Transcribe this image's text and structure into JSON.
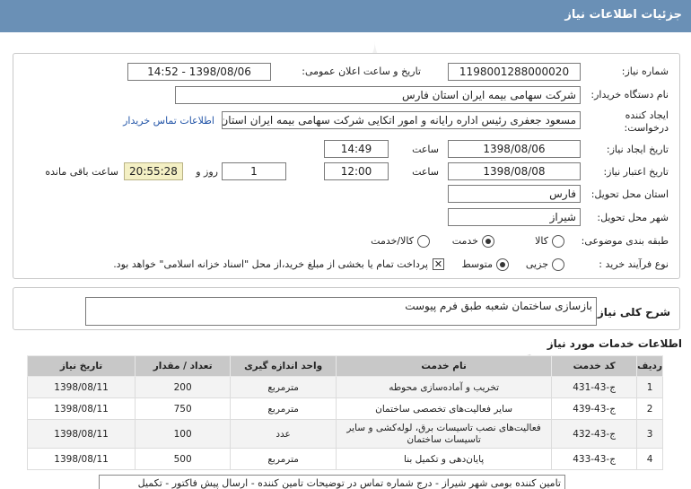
{
  "header": {
    "title": "جزئيات اطلاعات نیاز"
  },
  "form": {
    "need_number": {
      "label": "شماره نیاز:",
      "value": "1198001288000020"
    },
    "announce": {
      "label": "تاریخ و ساعت اعلان عمومی:",
      "value": "1398/08/06 - 14:52"
    },
    "buyer": {
      "label": "نام دستگاه خریدار:",
      "value": "شرکت سهامی بیمه ایران استان فارس"
    },
    "requester": {
      "label_line1": "ایجاد کننده",
      "label_line2": "درخواست:",
      "value": "مسعود جعفری رئیس اداره رایانه و امور اتکایی شرکت سهامی بیمه ایران استان",
      "contact_link": "اطلاعات تماس خریدار"
    },
    "created": {
      "label": "تاریخ ایجاد نیاز:",
      "date": "1398/08/06",
      "time_label": "ساعت",
      "time": "14:49"
    },
    "validity": {
      "label": "تاریخ اعتبار نیاز:",
      "date": "1398/08/08",
      "time_label": "ساعت",
      "time": "12:00",
      "days": "1",
      "days_label": "روز و",
      "remaining": "20:55:28",
      "remaining_label": "ساعت باقی مانده"
    },
    "province": {
      "label": "استان محل تحویل:",
      "value": "فارس"
    },
    "city": {
      "label": "شهر محل تحویل:",
      "value": "شیراز"
    },
    "category": {
      "label": "طبقه بندی موضوعی:",
      "options": [
        "کالا",
        "خدمت",
        "کالا/خدمت"
      ],
      "selected": "خدمت"
    },
    "process": {
      "label": "نوع فرآیند خرید :",
      "options": [
        "جزیی",
        "متوسط"
      ],
      "selected": "متوسط",
      "note": "پرداخت تمام یا بخشی از مبلغ خرید،از محل \"اسناد خزانه اسلامی\" خواهد بود."
    }
  },
  "description": {
    "label": "شرح کلی نیاز:",
    "value": "بازسازی ساختمان شعبه طبق فرم پیوست"
  },
  "services": {
    "title": "اطلاعات خدمات مورد نیاز",
    "columns": [
      "ردیف",
      "کد خدمت",
      "نام خدمت",
      "واحد اندازه گیری",
      "تعداد / مقدار",
      "تاریخ نیاز"
    ],
    "rows": [
      {
        "idx": "1",
        "code": "ج-43-431",
        "name": "تخریب و آماده‌سازی محوطه",
        "unit": "مترمربع",
        "qty": "200",
        "date": "1398/08/11"
      },
      {
        "idx": "2",
        "code": "ج-43-439",
        "name": "سایر فعالیت‌های تخصصی ساختمان",
        "unit": "مترمربع",
        "qty": "750",
        "date": "1398/08/11"
      },
      {
        "idx": "3",
        "code": "ج-43-432",
        "name_line1": "فعالیت‌های نصب تاسیسات برق، لوله‌کشی و سایر",
        "name_line2": "تاسیسات ساختمان",
        "unit": "عدد",
        "qty": "100",
        "date": "1398/08/11"
      },
      {
        "idx": "4",
        "code": "ج-43-433",
        "name": "پایان‌دهی و تکمیل بنا",
        "unit": "مترمربع",
        "qty": "500",
        "date": "1398/08/11"
      }
    ]
  },
  "footnote": "تامین کننده بومی شهر شیراز - درج شماره تماس در توضیحات تامین کننده - ارسال پیش فاکتور - تکمیل"
}
